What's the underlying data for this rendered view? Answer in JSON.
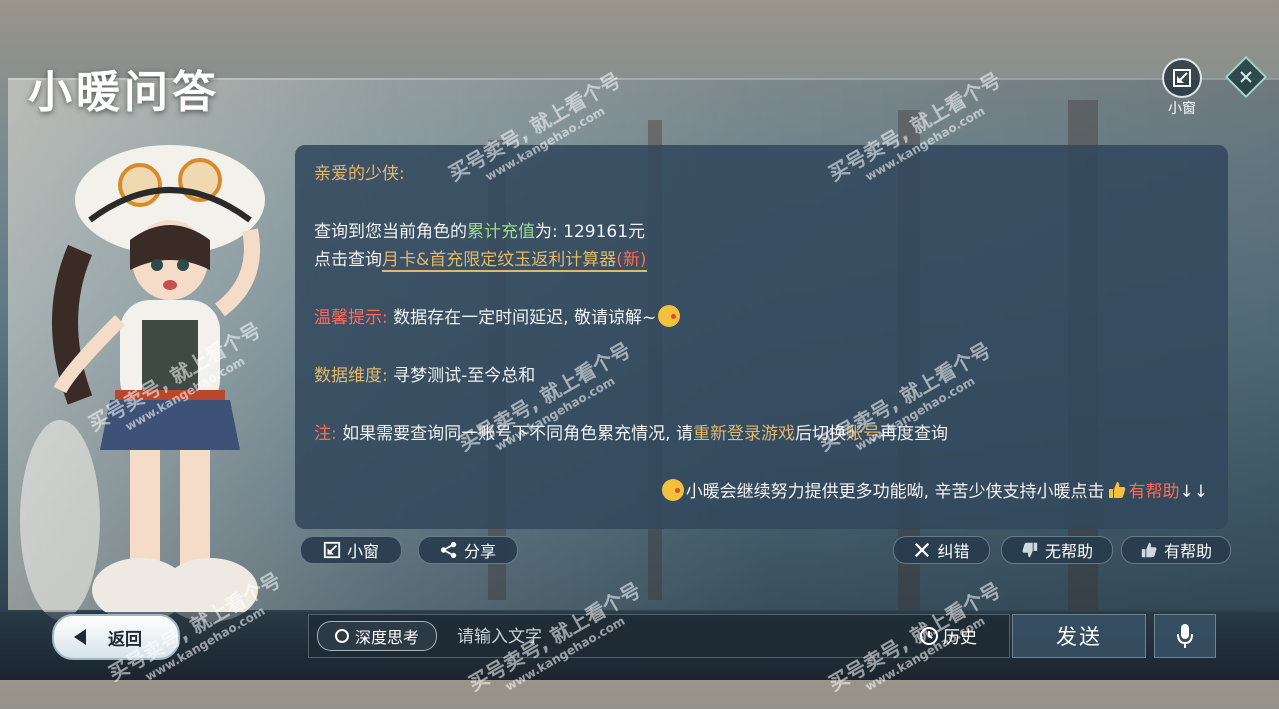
{
  "app_title": "小暖问答",
  "top_right": {
    "mini_window_label": "小窗"
  },
  "message": {
    "greeting": "亲爱的少侠:",
    "recharge_prefix": "查询到您当前角色的",
    "recharge_term": "累计充值",
    "recharge_suffix": "为: 129161元",
    "calc_prefix": "点击查询",
    "calc_link": "月卡&首充限定纹玉返利计算器",
    "calc_new": "(新)",
    "tip_label": "温馨提示:",
    "tip_text": " 数据存在一定时间延迟, 敬请谅解~",
    "dimension_label": "数据维度:",
    "dimension_text": " 寻梦测试-至今总和",
    "note_label": "注:",
    "note_text_1": " 如果需要查询同一账号下不同角色累充情况, 请",
    "note_action": "重新登录游戏",
    "note_text_2": "后切换",
    "note_account": "账号",
    "note_text_3": "再度查询",
    "footer_text": "小暖会继续努力提供更多功能呦, 辛苦少侠支持小暖点击",
    "footer_helpful": "有帮助",
    "footer_arrows": "↓↓"
  },
  "actions": {
    "mini_window": "小窗",
    "share": "分享",
    "correct": "纠错",
    "not_helpful": "无帮助",
    "helpful": "有帮助"
  },
  "bottom": {
    "back": "返回",
    "deep_think": "深度思考",
    "input_placeholder": "请输入文字",
    "history": "历史",
    "send": "发送"
  },
  "watermark": {
    "text": "买号卖号, 就上看个号",
    "url": "www.kangehao.com",
    "brand": "看个号"
  },
  "colors": {
    "panel": "#32485c",
    "gold": "#e2b86c",
    "red": "#ff6a5a",
    "green": "#9edb8e"
  }
}
